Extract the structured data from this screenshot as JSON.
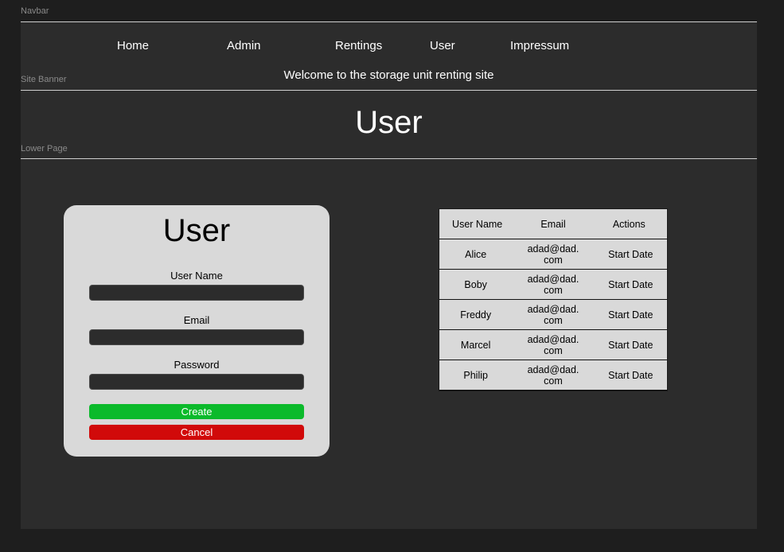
{
  "frame_labels": {
    "navbar": "Navbar",
    "site_banner": "Site Banner",
    "lower_page": "Lower Page"
  },
  "nav": {
    "items": [
      "Home",
      "Admin",
      "Rentings",
      "User",
      "Impressum"
    ]
  },
  "banner": {
    "text": "Welcome to the storage unit renting site"
  },
  "page": {
    "title": "User"
  },
  "form": {
    "title": "User",
    "fields": {
      "username_label": "User Name",
      "username_value": "",
      "email_label": "Email",
      "email_value": "",
      "password_label": "Password",
      "password_value": ""
    },
    "create_label": "Create",
    "cancel_label": "Cancel"
  },
  "table": {
    "headers": [
      "User Name",
      "Email",
      "Actions"
    ],
    "rows": [
      {
        "name": "Alice",
        "email": "adad@dad.\ncom",
        "action": "Start Date"
      },
      {
        "name": "Boby",
        "email": "adad@dad.\ncom",
        "action": "Start Date"
      },
      {
        "name": "Freddy",
        "email": "adad@dad.\ncom",
        "action": "Start Date"
      },
      {
        "name": "Marcel",
        "email": "adad@dad.\ncom",
        "action": "Start Date"
      },
      {
        "name": "Philip",
        "email": "adad@dad.\ncom",
        "action": "Start Date"
      }
    ]
  },
  "colors": {
    "background": "#1e1e1e",
    "frame": "#2c2c2c",
    "card": "#d9d9d9",
    "create": "#0bba2b",
    "cancel": "#d10a0a"
  }
}
